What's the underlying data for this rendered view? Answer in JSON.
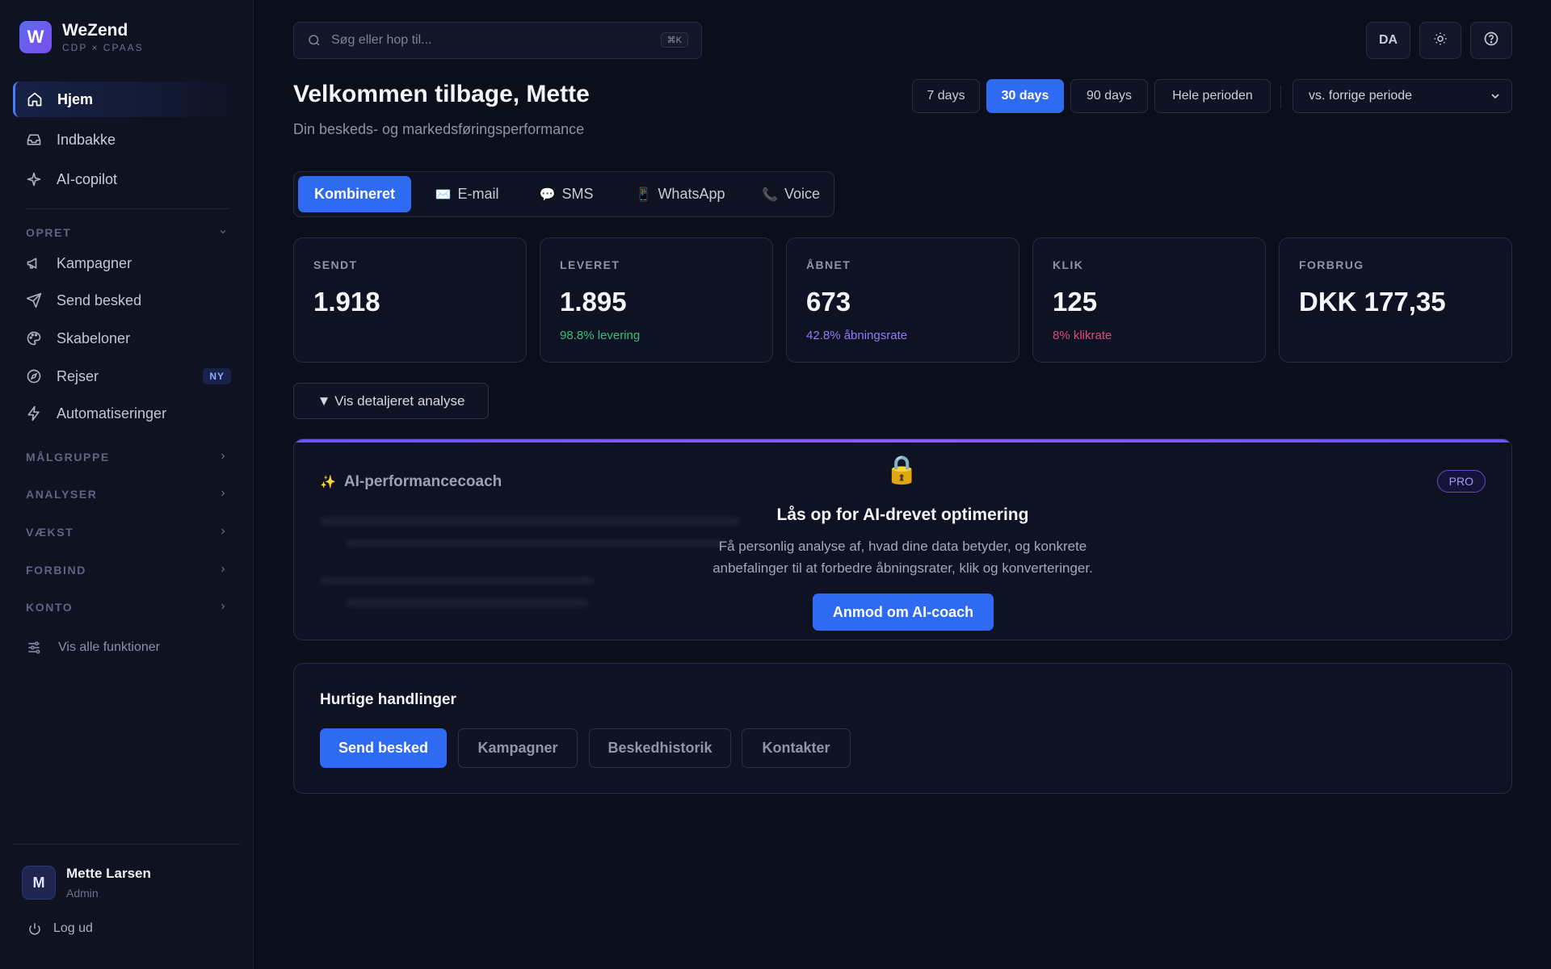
{
  "brand": {
    "logo_letter": "W",
    "name": "WeZend",
    "subtitle": "CDP × CPAAS"
  },
  "nav": {
    "main": [
      {
        "label": "Hjem",
        "icon": "home-icon",
        "active": true
      },
      {
        "label": "Indbakke",
        "icon": "inbox-icon"
      },
      {
        "label": "AI-copilot",
        "icon": "sparkle-icon"
      }
    ],
    "opret": {
      "heading": "OPRET",
      "items": [
        {
          "label": "Kampagner",
          "icon": "megaphone-icon"
        },
        {
          "label": "Send besked",
          "icon": "send-icon"
        },
        {
          "label": "Skabeloner",
          "icon": "palette-icon"
        },
        {
          "label": "Rejser",
          "icon": "compass-icon",
          "badge": "NY"
        },
        {
          "label": "Automatiseringer",
          "icon": "lightning-icon"
        }
      ]
    },
    "sections": [
      "MÅLGRUPPE",
      "ANALYSER",
      "VÆKST",
      "FORBIND",
      "KONTO"
    ],
    "show_all": "Vis alle funktioner"
  },
  "user": {
    "initial": "M",
    "name": "Mette Larsen",
    "role": "Admin",
    "logout": "Log ud"
  },
  "search": {
    "placeholder": "Søg eller hop til...",
    "shortcut": "⌘K"
  },
  "topbar": {
    "language": "DA"
  },
  "header": {
    "title": "Velkommen tilbage, Mette",
    "subtitle": "Din beskeds- og markedsføringsperformance"
  },
  "date_ranges": {
    "options": [
      "7 days",
      "30 days",
      "90 days",
      "Hele perioden"
    ],
    "selected": "30 days",
    "compare": "vs. forrige periode"
  },
  "channel_tabs": {
    "items": [
      {
        "label": "Kombineret",
        "emoji": ""
      },
      {
        "label": "E-mail",
        "emoji": "✉️"
      },
      {
        "label": "SMS",
        "emoji": "💬"
      },
      {
        "label": "WhatsApp",
        "emoji": "📱"
      },
      {
        "label": "Voice",
        "emoji": "📞"
      }
    ],
    "selected": "Kombineret"
  },
  "kpis": [
    {
      "label": "SENDT",
      "value": "1.918",
      "sub": "",
      "sub_color": ""
    },
    {
      "label": "LEVERET",
      "value": "1.895",
      "sub": "98.8% levering",
      "sub_color": "#34c17b"
    },
    {
      "label": "ÅBNET",
      "value": "673",
      "sub": "42.8% åbningsrate",
      "sub_color": "#8f7cf6"
    },
    {
      "label": "KLIK",
      "value": "125",
      "sub": "8% klikrate",
      "sub_color": "#e0487d"
    },
    {
      "label": "FORBRUG",
      "value": "DKK 177,35",
      "sub": "",
      "sub_color": ""
    }
  ],
  "analysis_toggle": "▼ Vis detaljeret analyse",
  "ai_coach": {
    "emoji": "✨",
    "title": "AI-performancecoach",
    "badge": "PRO",
    "lock": "🔒",
    "heading": "Lås op for AI-drevet optimering",
    "text_line1": "Få personlig analyse af, hvad dine data betyder, og konkrete",
    "text_line2": "anbefalinger til at forbedre åbningsrater, klik og konverteringer.",
    "cta": "Anmod om AI-coach"
  },
  "quick_actions": {
    "title": "Hurtige handlinger",
    "items": [
      "Send besked",
      "Kampagner",
      "Beskedhistorik",
      "Kontakter"
    ]
  },
  "colors": {
    "accent": "#2f6bf2",
    "background": "#0b0f1c",
    "card": "#0e1223",
    "success": "#34c17b",
    "purple": "#8f7cf6",
    "pink": "#e0487d"
  }
}
